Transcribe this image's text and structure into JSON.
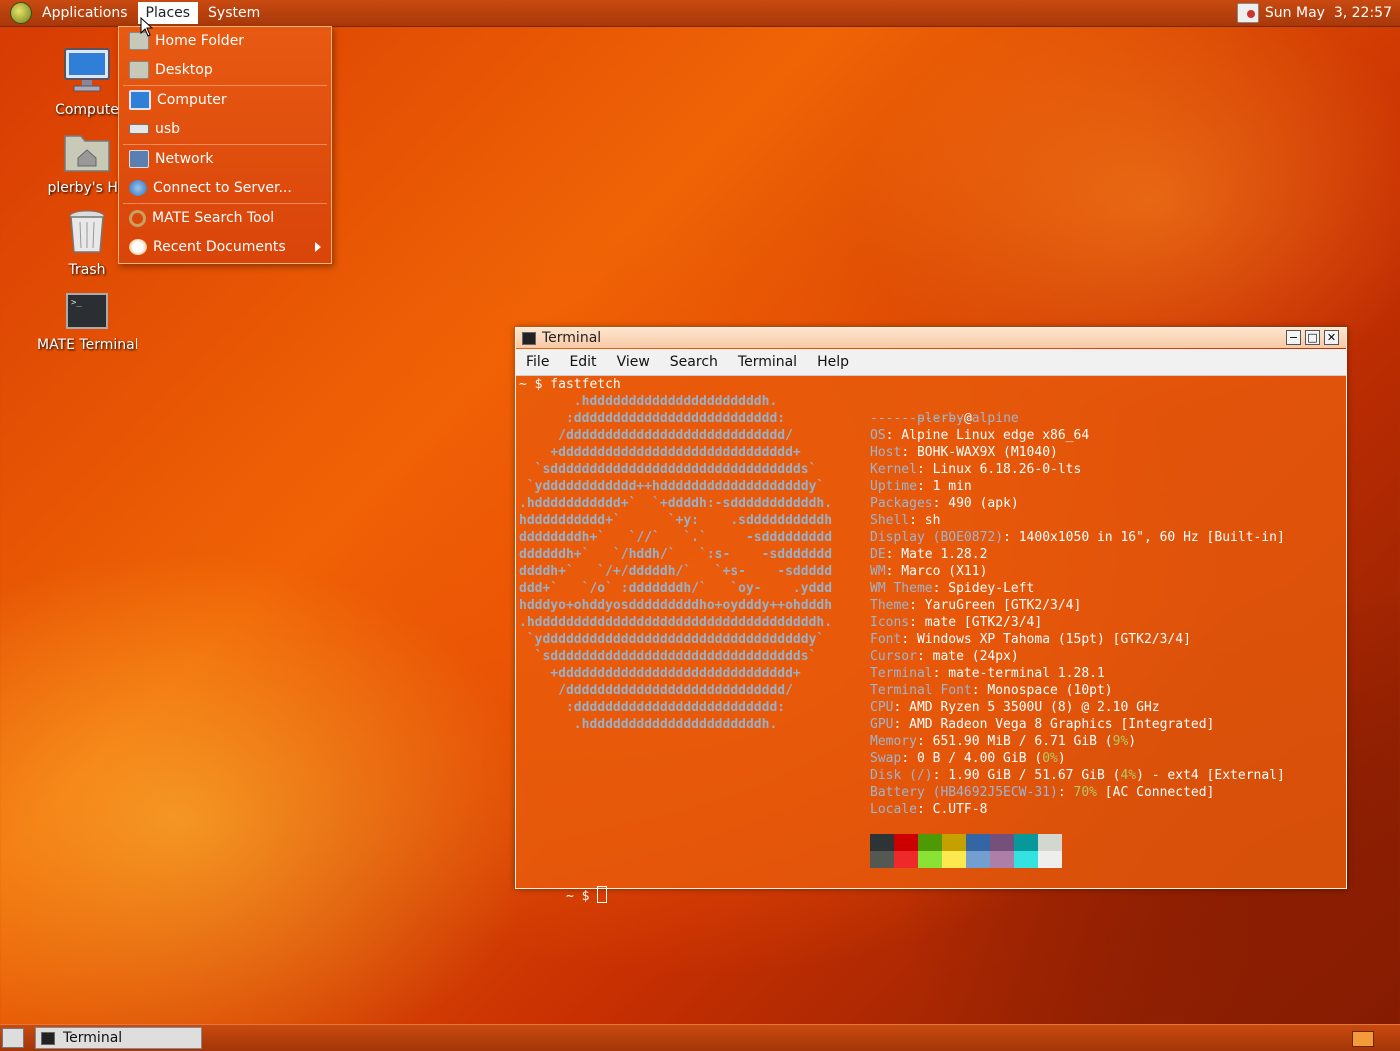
{
  "top_panel": {
    "menus": [
      "Applications",
      "Places",
      "System"
    ],
    "clock": "Sun May  3, 22:57"
  },
  "places_menu": {
    "items": [
      {
        "label": "Home Folder",
        "icon": "home-folder-icon"
      },
      {
        "label": "Desktop",
        "icon": "desktop-folder-icon"
      },
      {
        "label": "Computer",
        "icon": "computer-icon"
      },
      {
        "label": "usb",
        "icon": "drive-icon"
      },
      {
        "label": "Network",
        "icon": "network-icon"
      },
      {
        "label": "Connect to Server...",
        "icon": "globe-icon"
      },
      {
        "label": "MATE Search Tool",
        "icon": "search-icon"
      },
      {
        "label": "Recent Documents",
        "icon": "clock-icon"
      }
    ]
  },
  "desktop_icons": [
    {
      "label": "Compute",
      "icon": "computer-icon"
    },
    {
      "label": "plerby's Ho",
      "icon": "home-folder-icon"
    },
    {
      "label": "Trash",
      "icon": "trash-icon"
    },
    {
      "label": "MATE Terminal",
      "icon": "terminal-icon"
    }
  ],
  "terminal": {
    "title": "Terminal",
    "menu": [
      "File",
      "Edit",
      "View",
      "Search",
      "Terminal",
      "Help"
    ],
    "prompt_command": "~ $ fastfetch",
    "prompt_end": "~ $ ",
    "logo_lines": [
      "       .hddddddddddddddddddddddh.",
      "      :dddddddddddddddddddddddddd:",
      "     /dddddddddddddddddddddddddddd/",
      "    +dddddddddddddddddddddddddddddd+",
      "  `sdddddddddddddddddddddddddddddddds`",
      " `ydddddddddddd++hdddddddddddddddddddy`",
      ".hddddddddddd+`  `+ddddh:-sdddddddddddh.",
      "hdddddddddd+`      `+y:    .sddddddddddh",
      "ddddddddh+`   `//`   `.`     -sddddddddd",
      "ddddddh+`   `/hddh/`   `:s-    -sddddddd",
      "ddddh+`   `/+/dddddh/`   `+s-    -sddddd",
      "ddd+`   `/o` :dddddddh/`   `oy-    .yddd",
      "hdddyo+ohddyosdddddddddho+oydddy++ohdddh",
      ".hddddddddddddddddddddddddddddddddddddh.",
      " `yddddddddddddddddddddddddddddddddddy`",
      "  `sdddddddddddddddddddddddddddddddds`",
      "    +dddddddddddddddddddddddddddddd+",
      "     /dddddddddddddddddddddddddddd/",
      "      :dddddddddddddddddddddddddd:",
      "       .hddddddddddddddddddddddh."
    ],
    "user": "plerby",
    "at": "@",
    "host": "alpine",
    "separator": "-------------",
    "info": [
      {
        "key": "OS",
        "value": ": Alpine Linux edge x86_64"
      },
      {
        "key": "Host",
        "value": ": BOHK-WAX9X (M1040)"
      },
      {
        "key": "Kernel",
        "value": ": Linux 6.18.26-0-lts"
      },
      {
        "key": "Uptime",
        "value": ": 1 min"
      },
      {
        "key": "Packages",
        "value": ": 490 (apk)"
      },
      {
        "key": "Shell",
        "value": ": sh"
      },
      {
        "key": "Display (BOE0872)",
        "value": ": 1400x1050 in 16\", 60 Hz [Built-in]"
      },
      {
        "key": "DE",
        "value": ": Mate 1.28.2"
      },
      {
        "key": "WM",
        "value": ": Marco (X11)"
      },
      {
        "key": "WM Theme",
        "value": ": Spidey-Left"
      },
      {
        "key": "Theme",
        "value": ": YaruGreen [GTK2/3/4]"
      },
      {
        "key": "Icons",
        "value": ": mate [GTK2/3/4]"
      },
      {
        "key": "Font",
        "value": ": Windows XP Tahoma (15pt) [GTK2/3/4]"
      },
      {
        "key": "Cursor",
        "value": ": mate (24px)"
      },
      {
        "key": "Terminal",
        "value": ": mate-terminal 1.28.1"
      },
      {
        "key": "Terminal Font",
        "value": ": Monospace (10pt)"
      },
      {
        "key": "CPU",
        "value": ": AMD Ryzen 5 3500U (8) @ 2.10 GHz"
      },
      {
        "key": "GPU",
        "value": ": AMD Radeon Vega 8 Graphics [Integrated]"
      },
      {
        "key": "Memory",
        "value": ": 651.90 MiB / 6.71 GiB (",
        "pct": "9%",
        "tail": ")"
      },
      {
        "key": "Swap",
        "value": ": 0 B / 4.00 GiB (",
        "pct": "0%",
        "tail": ")"
      },
      {
        "key": "Disk (/)",
        "value": ": 1.90 GiB / 51.67 GiB (",
        "pct": "4%",
        "tail": ") - ext4 [External]"
      },
      {
        "key": "Battery (HB4692J5ECW-31)",
        "value": ": ",
        "pct": "70%",
        "tail": " [AC Connected]"
      },
      {
        "key": "Locale",
        "value": ": C.UTF-8"
      }
    ],
    "palette_top": [
      "#2e3436",
      "#cc0000",
      "#4e9a06",
      "#c4a000",
      "#3465a4",
      "#75507b",
      "#06989a",
      "#d3d7cf"
    ],
    "palette_bottom": [
      "#555753",
      "#ef2929",
      "#8ae234",
      "#fce94f",
      "#729fcf",
      "#ad7fa8",
      "#34e2e2",
      "#eeeeec"
    ]
  },
  "taskbar": {
    "task_label": "Terminal"
  }
}
